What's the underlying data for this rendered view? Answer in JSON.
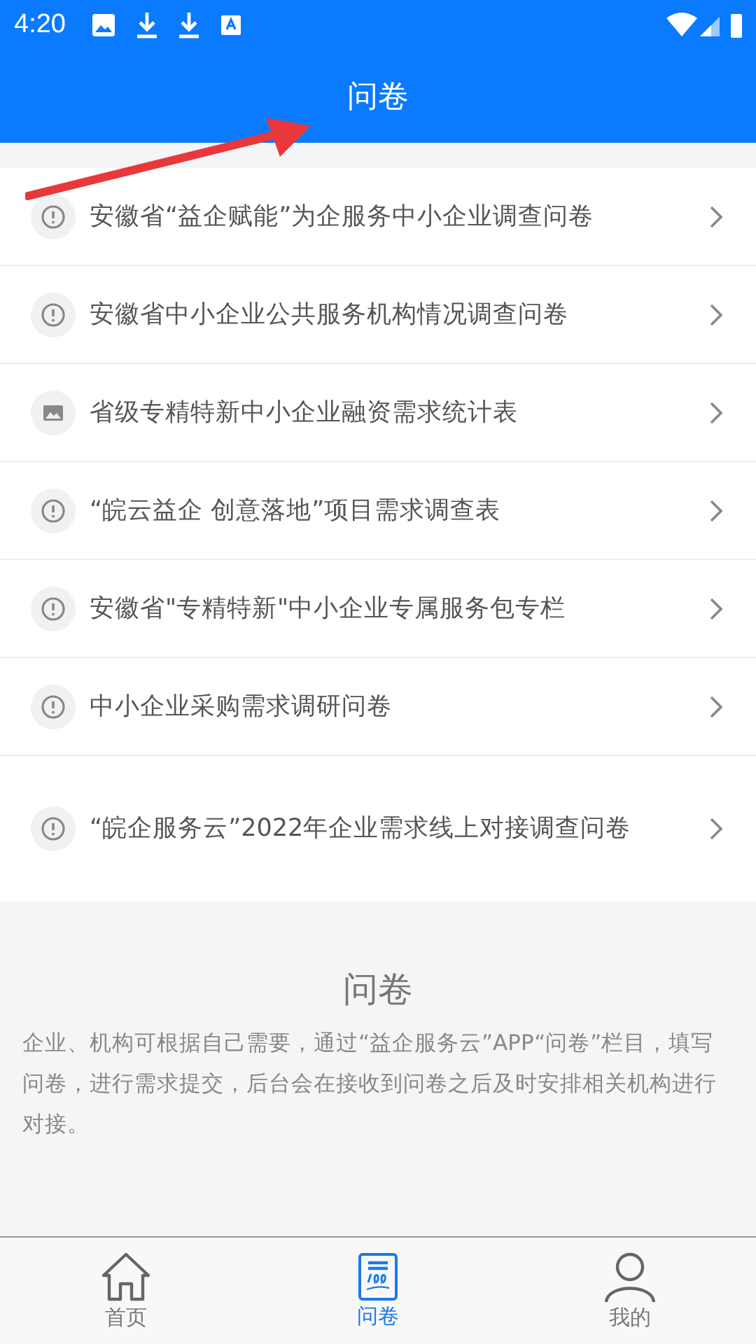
{
  "status_bar": {
    "time": "4:20"
  },
  "header": {
    "title": "问卷"
  },
  "surveys": [
    {
      "kind": "alert",
      "title": "安徽省“益企赋能”为企服务中小企业调查问卷"
    },
    {
      "kind": "alert",
      "title": "安徽省中小企业公共服务机构情况调查问卷"
    },
    {
      "kind": "image",
      "title": "省级专精特新中小企业融资需求统计表"
    },
    {
      "kind": "alert",
      "title": "“皖云益企 创意落地”项目需求调查表"
    },
    {
      "kind": "alert",
      "title": "安徽省\"专精特新\"中小企业专属服务包专栏"
    },
    {
      "kind": "alert",
      "title": "中小企业采购需求调研问卷"
    },
    {
      "kind": "alert",
      "title": "“皖企服务云”2022年企业需求线上对接调查问卷"
    }
  ],
  "info": {
    "title": "问卷",
    "text": "企业、机构可根据自己需要，通过“益企服务云”APP“问卷”栏目，填写问卷，进行需求提交，后台会在接收到问卷之后及时安排相关机构进行对接。"
  },
  "bottom_nav": [
    {
      "kind": "home",
      "label": "首页",
      "selected": false
    },
    {
      "kind": "survey",
      "label": "问卷",
      "selected": true
    },
    {
      "kind": "profile",
      "label": "我的",
      "selected": false
    }
  ]
}
